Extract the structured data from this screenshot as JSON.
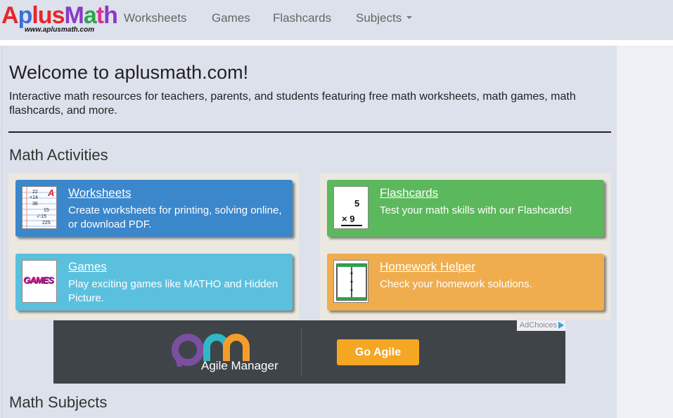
{
  "logo": {
    "letters": [
      "A",
      "p",
      "l",
      "u",
      "s",
      "M",
      "a",
      "t",
      "h"
    ],
    "url_text": "www.aplusmath.com"
  },
  "nav": {
    "items": [
      {
        "label": "Worksheets"
      },
      {
        "label": "Games"
      },
      {
        "label": "Flashcards"
      },
      {
        "label": "Subjects"
      }
    ]
  },
  "main": {
    "title": "Welcome to aplusmath.com!",
    "description": "Interactive math resources for teachers, parents, and students featuring free math worksheets, math games, math flashcards, and more.",
    "activities_heading": "Math Activities",
    "subjects_heading": "Math Subjects",
    "cards": [
      {
        "title": "Worksheets",
        "description": "Create worksheets for printing, solving online, or download PDF.",
        "color": "#3b87cc",
        "icon": "worksheet-icon"
      },
      {
        "title": "Flashcards",
        "description": "Test your math skills with our Flashcards!",
        "color": "#5cb85c",
        "icon": "flashcard-icon"
      },
      {
        "title": "Games",
        "description": "Play exciting games like MATHO and Hidden Picture.",
        "color": "#5bc0de",
        "icon": "games-icon"
      },
      {
        "title": "Homework Helper",
        "description": "Check your homework solutions.",
        "color": "#f0ad4e",
        "icon": "homework-helper-icon"
      }
    ],
    "worksheet_thumb": {
      "n1": "22",
      "n2": "+14",
      "n3": "36",
      "n4": "15",
      "n5": "√-15",
      "n6": "225",
      "grade": "A"
    },
    "flashcard_thumb": {
      "top": "5",
      "op": "× 9"
    },
    "games_thumb": {
      "text": "GAMES"
    }
  },
  "ad": {
    "adchoices": "AdChoices",
    "brand": "Agile Manager",
    "cta": "Go Agile"
  }
}
